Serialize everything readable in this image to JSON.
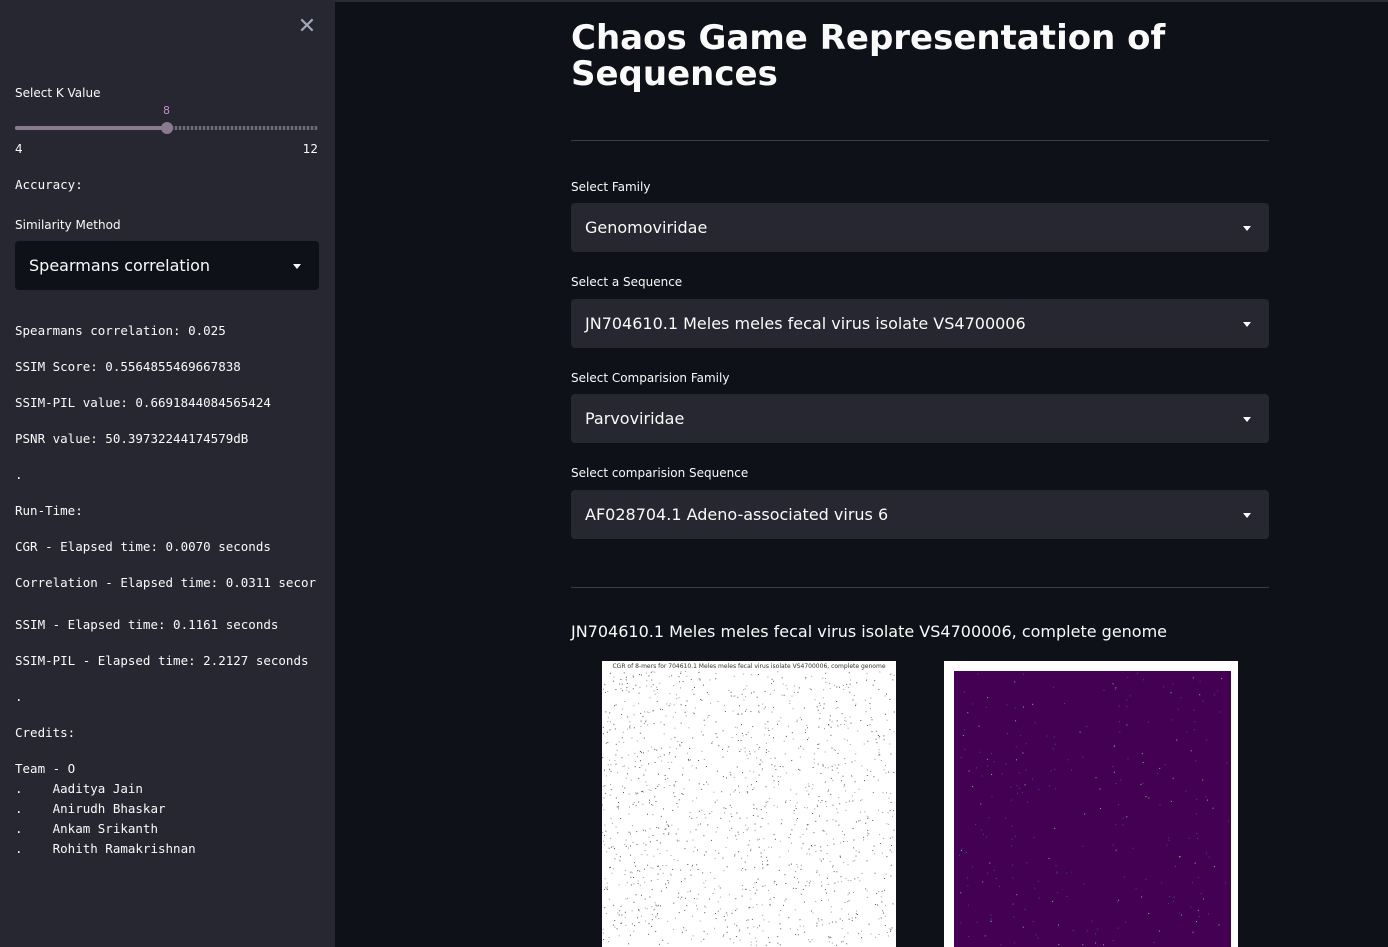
{
  "sidebar": {
    "close_icon": "close-icon",
    "k_label": "Select K Value",
    "k_value": "8",
    "k_min": "4",
    "k_max": "12",
    "k_fraction": 0.5,
    "accuracy_label": "Accuracy:",
    "similarity_label": "Similarity Method",
    "similarity_selected": "Spearmans correlation",
    "metrics": [
      "Spearmans correlation: 0.025",
      "SSIM Score: 0.5564855469667838",
      "SSIM-PIL value: 0.6691844084565424",
      "PSNR value: 50.39732244174579dB"
    ],
    "dot1": ".",
    "runtime_label": "Run-Time:",
    "runtimes": [
      "CGR - Elapsed time: 0.0070 seconds",
      "Correlation - Elapsed time: 0.0311 secor",
      "SSIM - Elapsed time: 0.1161 seconds",
      "SSIM-PIL - Elapsed time: 2.2127 seconds"
    ],
    "dot2": ".",
    "credits_label": "Credits:",
    "team": "Team - O",
    "members": [
      ".    Aaditya Jain",
      ".    Anirudh Bhaskar",
      ".    Ankam Srikanth",
      ".    Rohith Ramakrishnan"
    ]
  },
  "main": {
    "title": "Chaos Game Representation of Sequences",
    "family_label": "Select Family",
    "family_value": "Genomoviridae",
    "sequence_label": "Select a Sequence",
    "sequence_value": "JN704610.1 Meles meles fecal virus isolate VS4700006",
    "comp_family_label": "Select Comparision Family",
    "comp_family_value": "Parvoviridae",
    "comp_sequence_label": "Select comparision Sequence",
    "comp_sequence_value": "AF028704.1 Adeno-associated virus 6",
    "result_caption": "JN704610.1 Meles meles fecal virus isolate VS4700006, complete genome",
    "cgr_image_title": "CGR of 8-mers for 704610.1 Meles meles fecal virus isolate VS4700006, complete genome",
    "colors": {
      "accent": "#c58ad5",
      "heatmap_bg": "#440154"
    }
  }
}
